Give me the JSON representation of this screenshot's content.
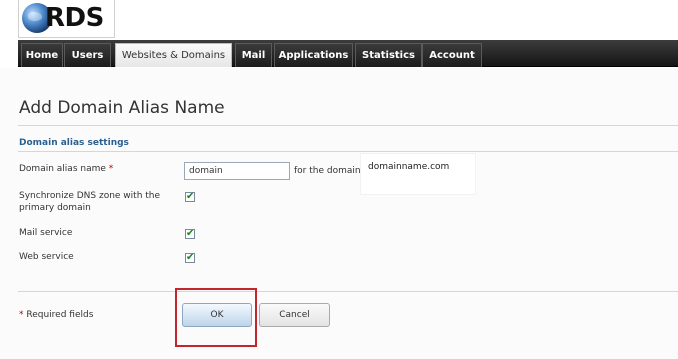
{
  "logo": {
    "text": "RDS"
  },
  "nav": {
    "tabs": [
      {
        "label": "Home"
      },
      {
        "label": "Users"
      },
      {
        "label": "Websites & Domains"
      },
      {
        "label": "Mail"
      },
      {
        "label": "Applications"
      },
      {
        "label": "Statistics"
      },
      {
        "label": "Account"
      }
    ],
    "active_tab": "Websites & Domains"
  },
  "page": {
    "title": "Add Domain Alias Name"
  },
  "form": {
    "section_title": "Domain alias settings",
    "alias_name": {
      "label": "Domain alias name",
      "required_mark": "*",
      "value": "domain"
    },
    "for_the_domain_text": "for the domain",
    "domain_name": "domainname.com",
    "sync_dns": {
      "label": "Synchronize DNS zone with the primary domain",
      "checked": true
    },
    "mail_service": {
      "label": "Mail service",
      "checked": true
    },
    "web_service": {
      "label": "Web service",
      "checked": true
    },
    "required_fields_text": "Required fields",
    "required_mark": "*",
    "ok_label": "OK",
    "cancel_label": "Cancel",
    "checkmark": "✔"
  },
  "colors": {
    "nav_bg": "#1c1c1c",
    "section_title": "#2b5f8f",
    "required": "#c00000",
    "highlight": "#c0272d",
    "checkmark": "#1b7f2a"
  }
}
